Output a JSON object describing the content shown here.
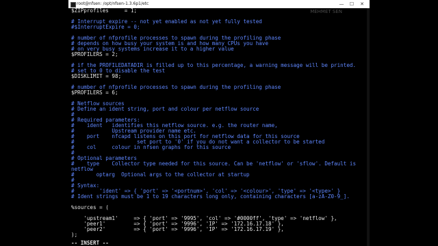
{
  "window": {
    "title": "root@nfsen: /opt/nfsen-1.3.6p1/etc",
    "minimize_label": "—",
    "maximize_label": "☐",
    "close_label": "✕",
    "watermark": "MEHMET SEN"
  },
  "terminal": {
    "lines": [
      {
        "kind": "code",
        "text": "$ZIPprofiles     = 1;"
      },
      {
        "kind": "blank",
        "text": ""
      },
      {
        "kind": "cmt",
        "text": "# Interrupt expire -- not yet enabled as not yet fully tested"
      },
      {
        "kind": "cmt",
        "text": "#$InterruptExpire = 0;"
      },
      {
        "kind": "blank",
        "text": ""
      },
      {
        "kind": "cmt",
        "text": "# number of nfprofile processes to spawn during the profiling phase"
      },
      {
        "kind": "cmt",
        "text": "# depends on how busy your system is and how many CPUs you have"
      },
      {
        "kind": "cmt",
        "text": "# on very busy systems increase it to a higher value"
      },
      {
        "kind": "code",
        "text": "$PROFILERS = 2;"
      },
      {
        "kind": "blank",
        "text": ""
      },
      {
        "kind": "cmt",
        "text": "# if the PROFILEDATADIR is filled up to this percentage, a warning message will be printed."
      },
      {
        "kind": "cmt",
        "text": "# set to 0 to disable the test"
      },
      {
        "kind": "code",
        "text": "$DISKLIMIT = 98;"
      },
      {
        "kind": "blank",
        "text": ""
      },
      {
        "kind": "cmt",
        "text": "# number of nfprofile processes to spawn during the profiling phase"
      },
      {
        "kind": "code",
        "text": "$PROFILERS = 6;"
      },
      {
        "kind": "blank",
        "text": ""
      },
      {
        "kind": "cmt",
        "text": "# Netflow sources"
      },
      {
        "kind": "cmt",
        "text": "# Define an ident string, port and colour per netflow source"
      },
      {
        "kind": "cmt",
        "text": "#"
      },
      {
        "kind": "cmt",
        "text": "# Required parameters:"
      },
      {
        "kind": "cmt",
        "text": "#    ident   identifies this netflow source. e.g. the router name,"
      },
      {
        "kind": "cmt",
        "text": "#            Upstream provider name etc."
      },
      {
        "kind": "cmt",
        "text": "#    port    nfcapd listens on this port for netflow data for this source"
      },
      {
        "kind": "cmt",
        "text": "#                    set port to '0' if you do not want a collector to be started"
      },
      {
        "kind": "cmt",
        "text": "#    col     colour in nfsen graphs for this source"
      },
      {
        "kind": "cmt",
        "text": "#"
      },
      {
        "kind": "cmt",
        "text": "# Optional parameters"
      },
      {
        "kind": "cmt",
        "text": "#    type    Collector type needed for this source. Can be 'netflow' or 'sflow'. Default is"
      },
      {
        "kind": "cmt",
        "text": "netflow"
      },
      {
        "kind": "cmt",
        "text": "#       optarg  Optional args to the collector at startup"
      },
      {
        "kind": "cmt",
        "text": "#"
      },
      {
        "kind": "cmt",
        "text": "# Syntax:"
      },
      {
        "kind": "cmt",
        "text": "#        'ident' => { 'port' => '<portnum>', 'col' => '<colour>', 'type' => '<type>' }"
      },
      {
        "kind": "cmt",
        "text": "# Ident strings must be 1 to 19 characters long only, containing characters [a-zA-Z0-9_]."
      },
      {
        "kind": "blank",
        "text": ""
      },
      {
        "kind": "code",
        "text": "%sources = ("
      },
      {
        "kind": "blank",
        "text": ""
      },
      {
        "kind": "code",
        "text": "    'upstream1'     => { 'port' => '9995', 'col' => '#0000ff', 'type' => 'netflow' },"
      },
      {
        "kind": "code",
        "text": "    'peer1'         => { 'port' => '9996', 'IP' => '172.16.17.18' },"
      },
      {
        "kind": "code",
        "text": "    'peer2'         => { 'port' => '9996', 'IP' => '172.16.17.19' },"
      },
      {
        "kind": "code",
        "text": ");"
      }
    ],
    "status": "-- INSERT --"
  },
  "colors": {
    "comment": "#5f87ff",
    "code": "#e8e8e8",
    "background": "#000000"
  }
}
